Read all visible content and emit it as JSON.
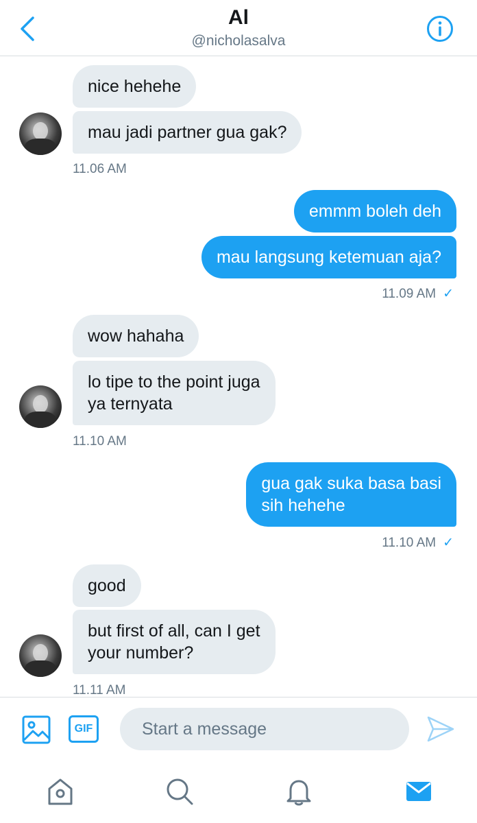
{
  "header": {
    "title": "Al",
    "handle": "@nicholasalva"
  },
  "messages": {
    "g1": {
      "m1": "nice hehehe",
      "m2": "mau jadi partner gua gak?",
      "time": "11.06 AM"
    },
    "g2": {
      "m1": "emmm boleh deh",
      "m2": "mau langsung ketemuan aja?",
      "time": "11.09 AM",
      "check": "✓"
    },
    "g3": {
      "m1": "wow hahaha",
      "m2a": "lo tipe to the point juga",
      "m2b": "ya ternyata",
      "time": "11.10 AM"
    },
    "g4": {
      "m1a": "gua gak suka basa basi",
      "m1b": "sih hehehe",
      "time": "11.10 AM",
      "check": "✓"
    },
    "g5": {
      "m1": "good",
      "m2a": "but first of all, can I get",
      "m2b": "your number?",
      "time": "11.11 AM"
    }
  },
  "composer": {
    "placeholder": "Start a message",
    "gif_label": "GIF"
  },
  "icons": {
    "back": "chevron-left-icon",
    "info": "info-icon",
    "media": "image-icon",
    "send": "send-icon",
    "home": "home-icon",
    "search": "search-icon",
    "notifications": "bell-icon",
    "messages": "mail-icon"
  },
  "colors": {
    "accent": "#1da1f2",
    "incoming_bubble": "#e6ecf0",
    "secondary_text": "#657786"
  }
}
